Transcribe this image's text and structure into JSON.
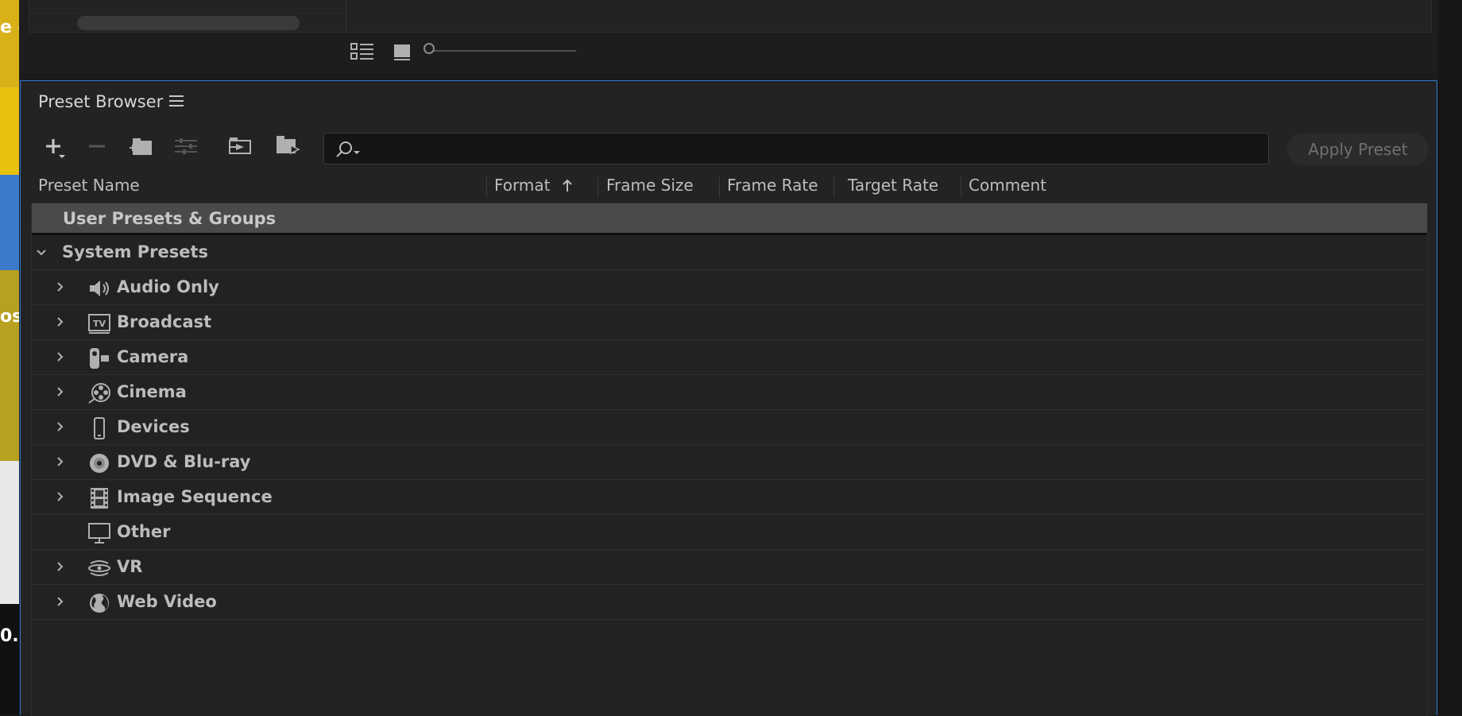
{
  "left_strip": {
    "fragments": [
      "e c",
      "os",
      "0."
    ]
  },
  "panel": {
    "title": "Preset Browser",
    "menu_icon": "hamburger-menu-icon"
  },
  "toolbar": {
    "icons": [
      "plus-dropdown-icon",
      "minus-icon",
      "new-group-icon",
      "preset-settings-icon",
      "import-preset-icon",
      "export-preset-icon"
    ],
    "search_icon": "search-dropdown-icon",
    "search_value": "",
    "apply_label": "Apply Preset"
  },
  "columns": [
    {
      "label": "Preset Name"
    },
    {
      "label": "Format"
    },
    {
      "label": "Frame Size"
    },
    {
      "label": "Frame Rate"
    },
    {
      "label": "Target Rate"
    },
    {
      "label": "Comment"
    }
  ],
  "sort_icon": "sort-ascending-icon",
  "tree": {
    "user_group": "User Presets & Groups",
    "system_group": "System Presets",
    "items": [
      {
        "label": "Audio Only",
        "icon": "speaker-icon"
      },
      {
        "label": "Broadcast",
        "icon": "tv-icon"
      },
      {
        "label": "Camera",
        "icon": "camera-icon"
      },
      {
        "label": "Cinema",
        "icon": "film-reel-icon"
      },
      {
        "label": "Devices",
        "icon": "phone-icon"
      },
      {
        "label": "DVD & Blu-ray",
        "icon": "disc-icon"
      },
      {
        "label": "Image Sequence",
        "icon": "filmstrip-icon"
      },
      {
        "label": "Other",
        "icon": "monitor-icon"
      },
      {
        "label": "VR",
        "icon": "vr-headset-icon"
      },
      {
        "label": "Web Video",
        "icon": "globe-icon"
      }
    ]
  },
  "colors": {
    "accent_border": "#2d7ad6",
    "panel_bg": "#232323",
    "selected_row": "#4a4a4a"
  }
}
